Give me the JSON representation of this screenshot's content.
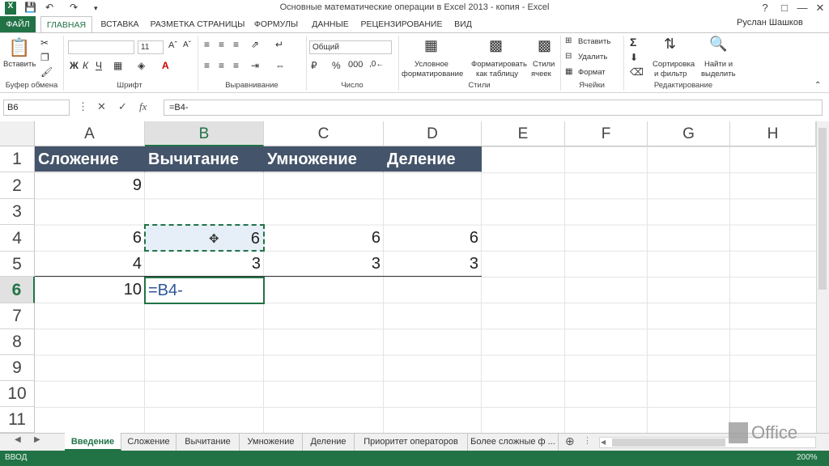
{
  "window": {
    "title": "Основные математические операции в Excel 2013 - копия - Excel",
    "user": "Руслан Шашков",
    "help": "?"
  },
  "tabs": [
    "ФАЙЛ",
    "ГЛАВНАЯ",
    "ВСТАВКА",
    "РАЗМЕТКА СТРАНИЦЫ",
    "ФОРМУЛЫ",
    "ДАННЫЕ",
    "РЕЦЕНЗИРОВАНИЕ",
    "ВИД"
  ],
  "ribbon": {
    "paste_label": "Вставить",
    "font_name": "",
    "font_size": "11",
    "number_format": "Общий",
    "cond_format": "Условное",
    "cond_format2": "форматирование",
    "format_table": "Форматировать",
    "format_table2": "как таблицу",
    "cell_styles": "Стили",
    "cell_styles2": "ячеек",
    "insert": "Вставить",
    "delete": "Удалить",
    "format": "Формат",
    "sort_filter": "Сортировка",
    "sort_filter2": "и фильтр",
    "find_select": "Найти и",
    "find_select2": "выделить",
    "groups": {
      "clipboard": "Буфер обмена",
      "font": "Шрифт",
      "alignment": "Выравнивание",
      "number": "Число",
      "styles": "Стили",
      "cells": "Ячейки",
      "editing": "Редактирование"
    }
  },
  "formula_bar": {
    "name_box": "B6",
    "formula": "=B4-"
  },
  "grid": {
    "columns": [
      "A",
      "B",
      "C",
      "D",
      "E",
      "F",
      "G",
      "H"
    ],
    "rows": [
      "1",
      "2",
      "3",
      "4",
      "5",
      "6",
      "7",
      "8",
      "9",
      "10",
      "11"
    ],
    "cells": {
      "A1": "Сложение",
      "B1": "Вычитание",
      "C1": "Умножение",
      "D1": "Деление",
      "A2": "9",
      "A4": "6",
      "B4": "6",
      "C4": "6",
      "D4": "6",
      "A5": "4",
      "B5": "3",
      "C5": "3",
      "D5": "3",
      "A6": "10",
      "B6": "=B4-"
    }
  },
  "sheets": [
    "Введение",
    "Сложение",
    "Вычитание",
    "Умножение",
    "Деление",
    "Приоритет операторов",
    "Более сложные ф ..."
  ],
  "status": {
    "mode": "ВВОД",
    "zoom": "200%"
  },
  "watermark": "Office"
}
